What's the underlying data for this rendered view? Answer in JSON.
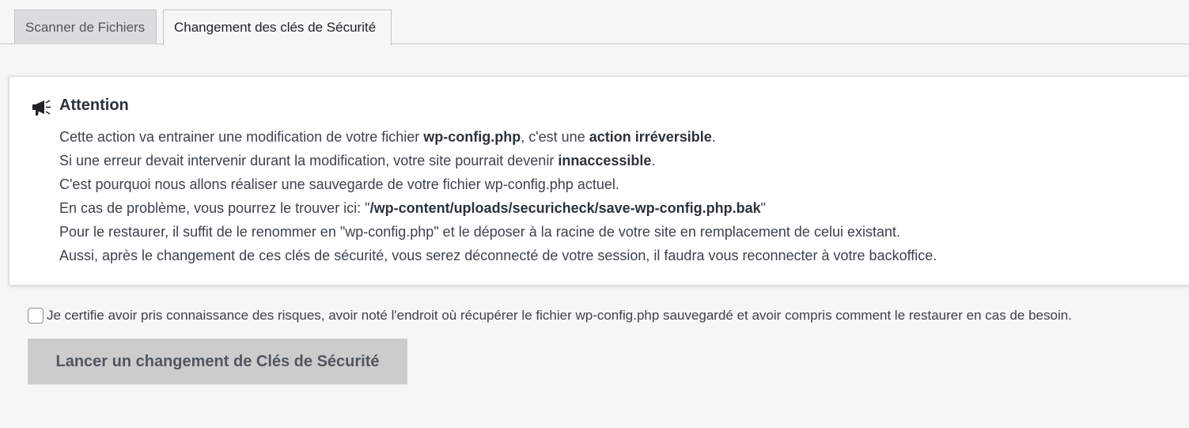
{
  "tabs": [
    {
      "label": "Scanner de Fichiers",
      "active": false
    },
    {
      "label": "Changement des clés de Sécurité",
      "active": true
    }
  ],
  "notice": {
    "icon": "megaphone-icon",
    "title": "Attention",
    "line1": {
      "t1": "Cette action va entrainer une modification de votre fichier ",
      "b1": "wp-config.php",
      "t2": ", c'est une ",
      "b2": "action irréversible",
      "t3": "."
    },
    "line2": {
      "t1": "Si une erreur devait intervenir durant la modification, votre site pourrait devenir ",
      "b1": "innaccessible",
      "t2": "."
    },
    "line3": "C'est pourquoi nous allons réaliser une sauvegarde de votre fichier wp-config.php actuel.",
    "line4": {
      "t1": "En cas de problème, vous pourrez le trouver ici: \"",
      "b1": "/wp-content/uploads/securicheck/save-wp-config.php.bak",
      "t2": "\""
    },
    "line5": "Pour le restaurer, il suffit de le renommer en \"wp-config.php\" et le déposer à la racine de votre site en remplacement de celui existant.",
    "line6": "Aussi, après le changement de ces clés de sécurité, vous serez déconnecté de votre session, il faudra vous reconnecter à votre backoffice."
  },
  "confirm": {
    "checked": false,
    "label": "Je certifie avoir pris connaissance des risques, avoir noté l'endroit où récupérer le fichier wp-config.php sauvegardé et avoir compris comment le restaurer en cas de besoin."
  },
  "launch_button": {
    "label": "Lancer un changement de Clés de Sécurité",
    "disabled": true
  }
}
